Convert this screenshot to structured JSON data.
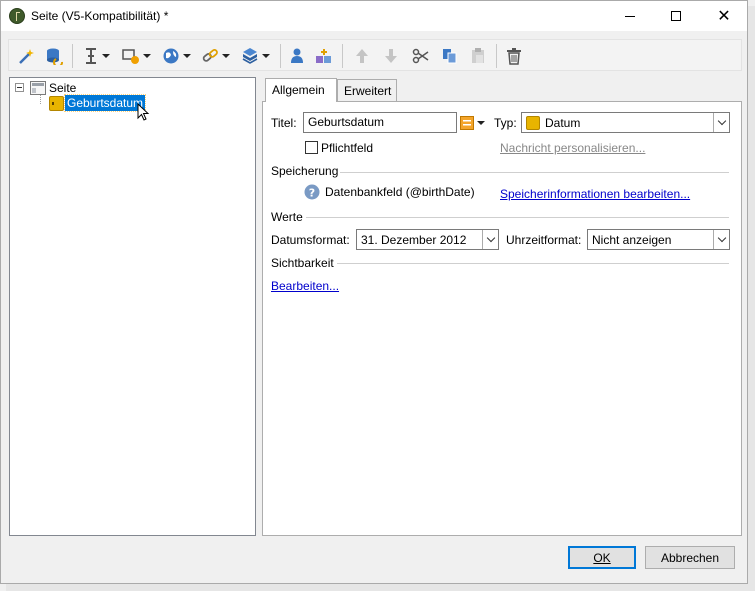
{
  "window": {
    "title": "Seite (V5-Kompatibilität) *"
  },
  "toolbar": {
    "icons": [
      "wand-icon",
      "database-icon",
      "text-cursor-icon",
      "input-field-icon",
      "globe-icon",
      "link-icon",
      "cube-icon",
      "user-icon",
      "add-shapes-icon",
      "arrow-up-icon",
      "arrow-down-icon",
      "cut-icon",
      "copy-icon",
      "paste-icon",
      "delete-icon"
    ]
  },
  "tree": {
    "root_label": "Seite",
    "child_label": "Geburtsdatum"
  },
  "tabs": {
    "general": "Allgemein",
    "advanced": "Erweitert"
  },
  "form": {
    "title_label": "Titel:",
    "title_value": "Geburtsdatum",
    "type_label": "Typ:",
    "type_value": "Datum",
    "required_label": "Pflichtfeld",
    "required_checked": false,
    "personalize_link": "Nachricht personalisieren...",
    "storage_section": "Speicherung",
    "db_field": "Datenbankfeld (@birthDate)",
    "storage_link": "Speicherinformationen bearbeiten...",
    "values_section": "Werte",
    "date_format_label": "Datumsformat:",
    "date_format_value": "31. Dezember 2012",
    "time_format_label": "Uhrzeitformat:",
    "time_format_value": "Nicht anzeigen",
    "visibility_section": "Sichtbarkeit",
    "edit_link": "Bearbeiten..."
  },
  "buttons": {
    "ok": "OK",
    "cancel": "Abbrechen"
  },
  "colors": {
    "selection": "#0078d7",
    "link": "#0000cc",
    "accent_date": "#e8b400"
  }
}
